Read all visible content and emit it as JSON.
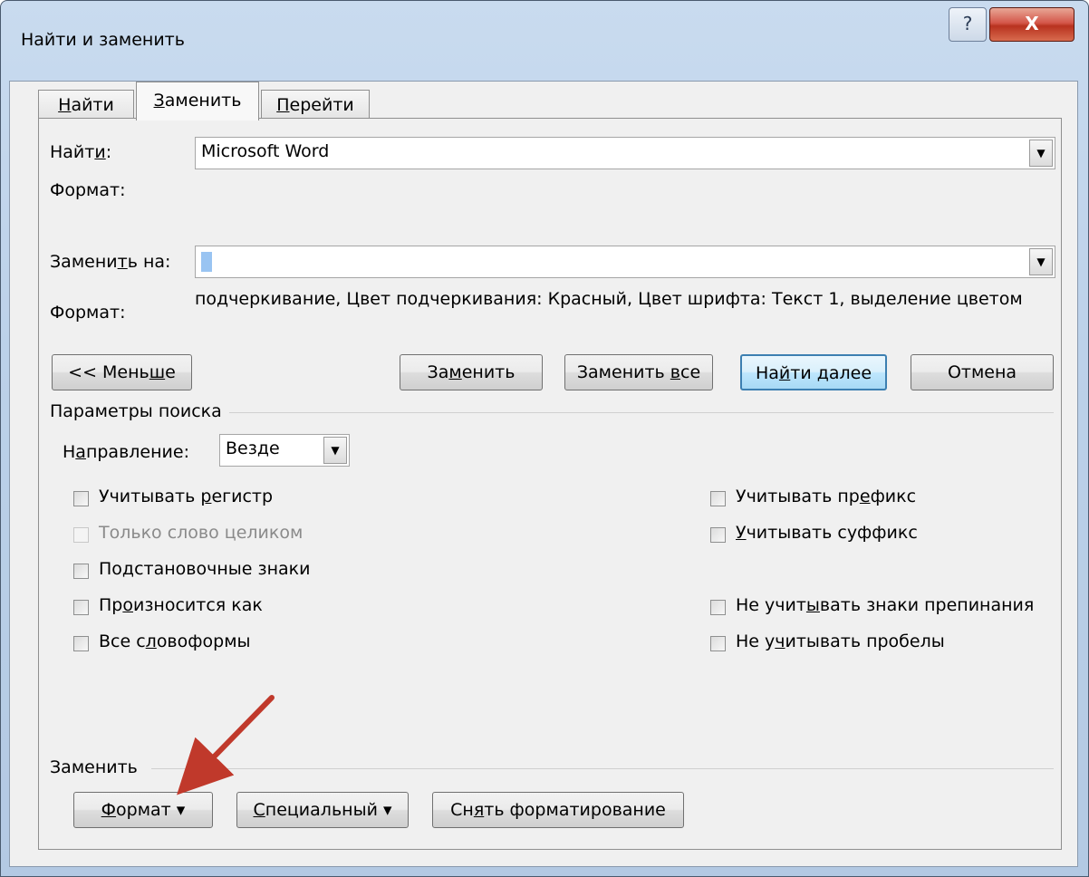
{
  "window": {
    "title": "Найти и заменить",
    "help_label": "?",
    "close_label": "X"
  },
  "tabs": [
    {
      "pre": "",
      "u": "Н",
      "post": "айти"
    },
    {
      "pre": "",
      "u": "З",
      "post": "аменить"
    },
    {
      "pre": "",
      "u": "П",
      "post": "ерейти"
    }
  ],
  "find": {
    "label_pre": "Найт",
    "label_u": "и",
    "label_post": ":",
    "value": "Microsoft Word",
    "format_label": "Формат:"
  },
  "replace": {
    "label_pre": "Замени",
    "label_u": "т",
    "label_post": "ь на:",
    "value": "",
    "format_label": "Формат:",
    "format_value": "подчеркивание, Цвет подчеркивания: Красный, Цвет шрифта: Текст 1, выделение цветом"
  },
  "buttons": {
    "less": {
      "pre": "<< Мень",
      "u": "ш",
      "post": "е"
    },
    "replace": {
      "pre": "За",
      "u": "м",
      "post": "енить"
    },
    "replace_all": {
      "pre": "Заменить ",
      "u": "в",
      "post": "се"
    },
    "find_next": {
      "pre": "На",
      "u": "й",
      "post": "ти далее"
    },
    "cancel": {
      "label": "Отмена"
    }
  },
  "search_options": {
    "group_label": "Параметры поиска",
    "direction_label_pre": "Н",
    "direction_label_u": "а",
    "direction_label_post": "правление:",
    "direction_value": "Везде",
    "left": [
      {
        "pre": "Учитывать ",
        "u": "р",
        "post": "егистр",
        "checked": false,
        "disabled": false
      },
      {
        "pre": "Только слово целиком",
        "u": "",
        "post": "",
        "checked": false,
        "disabled": true
      },
      {
        "pre": "По",
        "u": "д",
        "post": "становочные знаки",
        "checked": false,
        "disabled": false
      },
      {
        "pre": "Пр",
        "u": "о",
        "post": "износится как",
        "checked": false,
        "disabled": false
      },
      {
        "pre": "Все с",
        "u": "л",
        "post": "овоформы",
        "checked": false,
        "disabled": false
      }
    ],
    "right": [
      {
        "pre": "Учитывать пр",
        "u": "е",
        "post": "фикс",
        "checked": false,
        "disabled": false
      },
      {
        "pre": "",
        "u": "У",
        "post": "читывать суффикс",
        "checked": false,
        "disabled": false
      },
      {
        "pre": "Не учит",
        "u": "ы",
        "post": "вать знаки препинания",
        "checked": false,
        "disabled": false
      },
      {
        "pre": "Не у",
        "u": "ч",
        "post": "итывать пробелы",
        "checked": false,
        "disabled": false
      }
    ]
  },
  "replace_group": {
    "group_label": "Заменить",
    "format_btn": {
      "pre": "",
      "u": "Ф",
      "post": "ормат ▾"
    },
    "special_btn": {
      "pre": "",
      "u": "С",
      "post": "пециальный ▾"
    },
    "clear_btn": {
      "pre": "Сн",
      "u": "я",
      "post": "ть форматирование"
    }
  },
  "colors": {
    "annotation_arrow": "#c0392b",
    "default_button_border": "#3c7fb1",
    "caret": "#99c4f2"
  }
}
